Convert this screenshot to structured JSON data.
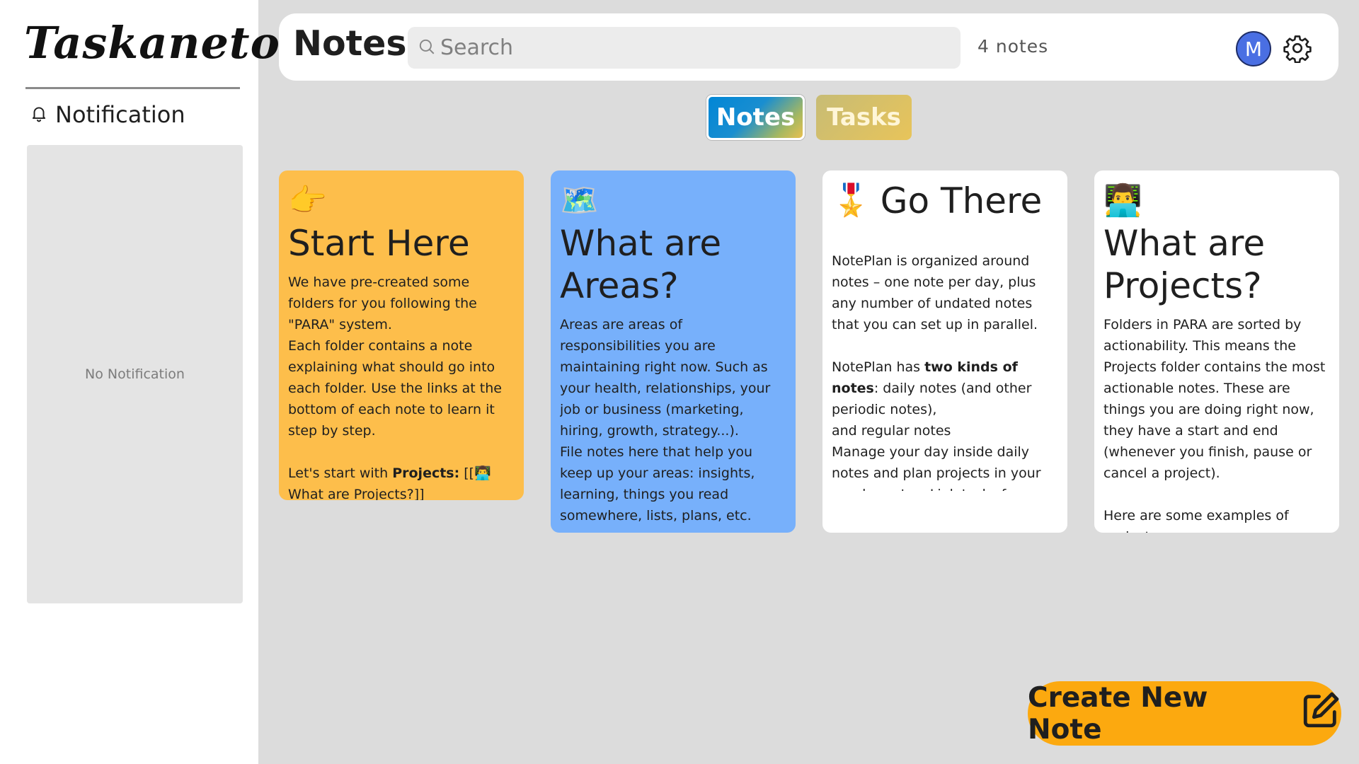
{
  "app": {
    "logo": "Taskaneto"
  },
  "sidebar": {
    "notification_title": "Notification",
    "empty_text": "No Notification"
  },
  "header": {
    "title": "Notes",
    "search_placeholder": "Search",
    "note_count": "4 notes",
    "avatar_initial": "M"
  },
  "tabs": [
    {
      "label": "Notes",
      "active": true
    },
    {
      "label": "Tasks",
      "active": false
    }
  ],
  "notes": [
    {
      "emoji": "👉",
      "title": "Start Here",
      "body_html": "We have pre-created some folders for you following the \"PARA\" system.\nEach folder contains a note explaining what should go into each folder. Use the links at the bottom of each note to learn it step by step.\n\nLet's start with <b>Projects:</b> [[👨‍💻 What are Projects?]]",
      "color": "#fdbe4b"
    },
    {
      "emoji": "🗺️",
      "title": "What are Areas?",
      "body_html": "Areas are areas of responsibilities you are maintaining right now. Such as your health, relationships, your job or business (marketing, hiring, growth, strategy...).\nFile notes here that help you keep up your areas: insights, learning, things you read somewhere, lists, plans, etc.\n\nHere are some examples of",
      "color": "#77b0fb"
    },
    {
      "emoji": "🎖️",
      "title": "Go There",
      "body_html": "NotePlan is organized around notes – one note per day, plus any number of undated notes that you can set up in parallel.\n\nNotePlan has <b>two kinds of notes</b>: daily notes (and other periodic notes),\nand regular notes\nManage your day inside daily notes and plan projects in your regular notes. Link tasks from your project notes to your daily",
      "color": "#ffffff"
    },
    {
      "emoji": "👨‍💻",
      "title": "What are Projects?",
      "body_html": "Folders in PARA are sorted by actionability. This means the Projects folder contains the most actionable notes. These are things you are doing right now, they have a start and end (whenever you finish, pause or cancel a project).\n\nHere are some examples of projects:\nWrite blog post",
      "color": "#ffffff"
    }
  ],
  "create_button": {
    "label": "Create New Note"
  },
  "colors": {
    "accent": "#fca90f",
    "avatar": "#4a6fe3",
    "background": "#dcdcdc"
  },
  "icons": {
    "notification": "bell-icon",
    "search": "search-icon",
    "settings": "gear-icon",
    "create": "edit-note-icon"
  }
}
